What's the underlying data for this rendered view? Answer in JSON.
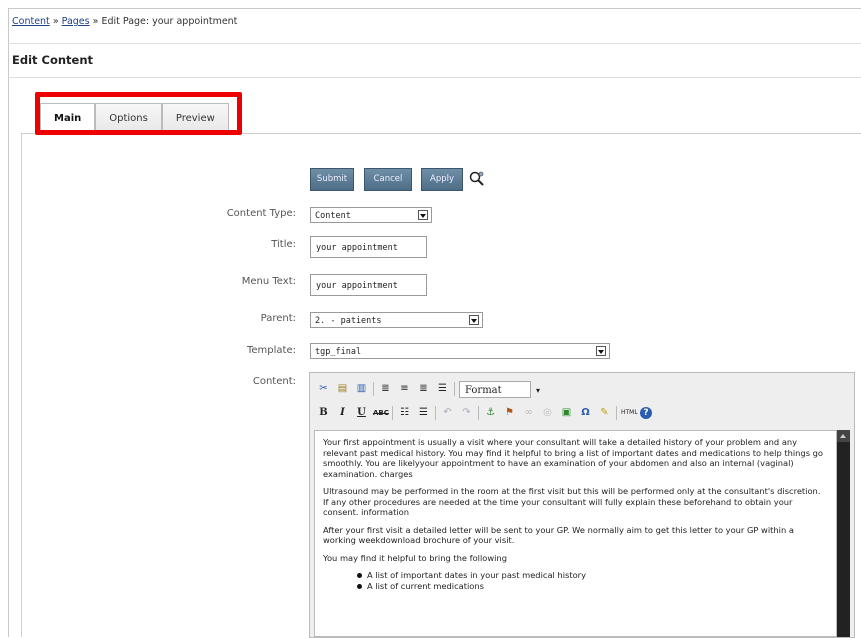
{
  "breadcrumb": {
    "link1": "Content",
    "sep": " » ",
    "link2": "Pages",
    "current": "Edit Page: your appointment"
  },
  "page_title": "Edit Content",
  "tabs": [
    "Main",
    "Options",
    "Preview"
  ],
  "buttons": {
    "submit": "Submit",
    "cancel": "Cancel",
    "apply": "Apply"
  },
  "form": {
    "content_type": {
      "label": "Content Type:",
      "value": "Content"
    },
    "title": {
      "label": "Title:",
      "value": "your appointment"
    },
    "menu_text": {
      "label": "Menu Text:",
      "value": "your appointment"
    },
    "parent": {
      "label": "Parent:",
      "value": "2. - patients"
    },
    "template": {
      "label": "Template:",
      "value": "tgp_final"
    },
    "content": {
      "label": "Content:"
    }
  },
  "editor": {
    "format_label": "Format",
    "paragraphs": [
      "Your first appointment is usually a visit where your consultant will take a detailed history of your problem and any relevant past medical history. You may find it helpful to bring a list of important dates and medications to help things go smoothly. You are likelyyour appointment to have an examination of your abdomen and also an internal (vaginal) examination. charges",
      "Ultrasound may be performed in the room at the first visit but this will be performed only at the consultant's discretion. If any other procedures are needed at the time your consultant will fully explain these beforehand to obtain your consent. information",
      "After your first visit a detailed letter will be sent to your GP. We normally aim to get this letter to your GP within a working weekdownload brochure of your visit.",
      "You may find it helpful to bring the following"
    ],
    "list_items": [
      "A list of important dates in your past medical history",
      "A list of current medications"
    ]
  }
}
